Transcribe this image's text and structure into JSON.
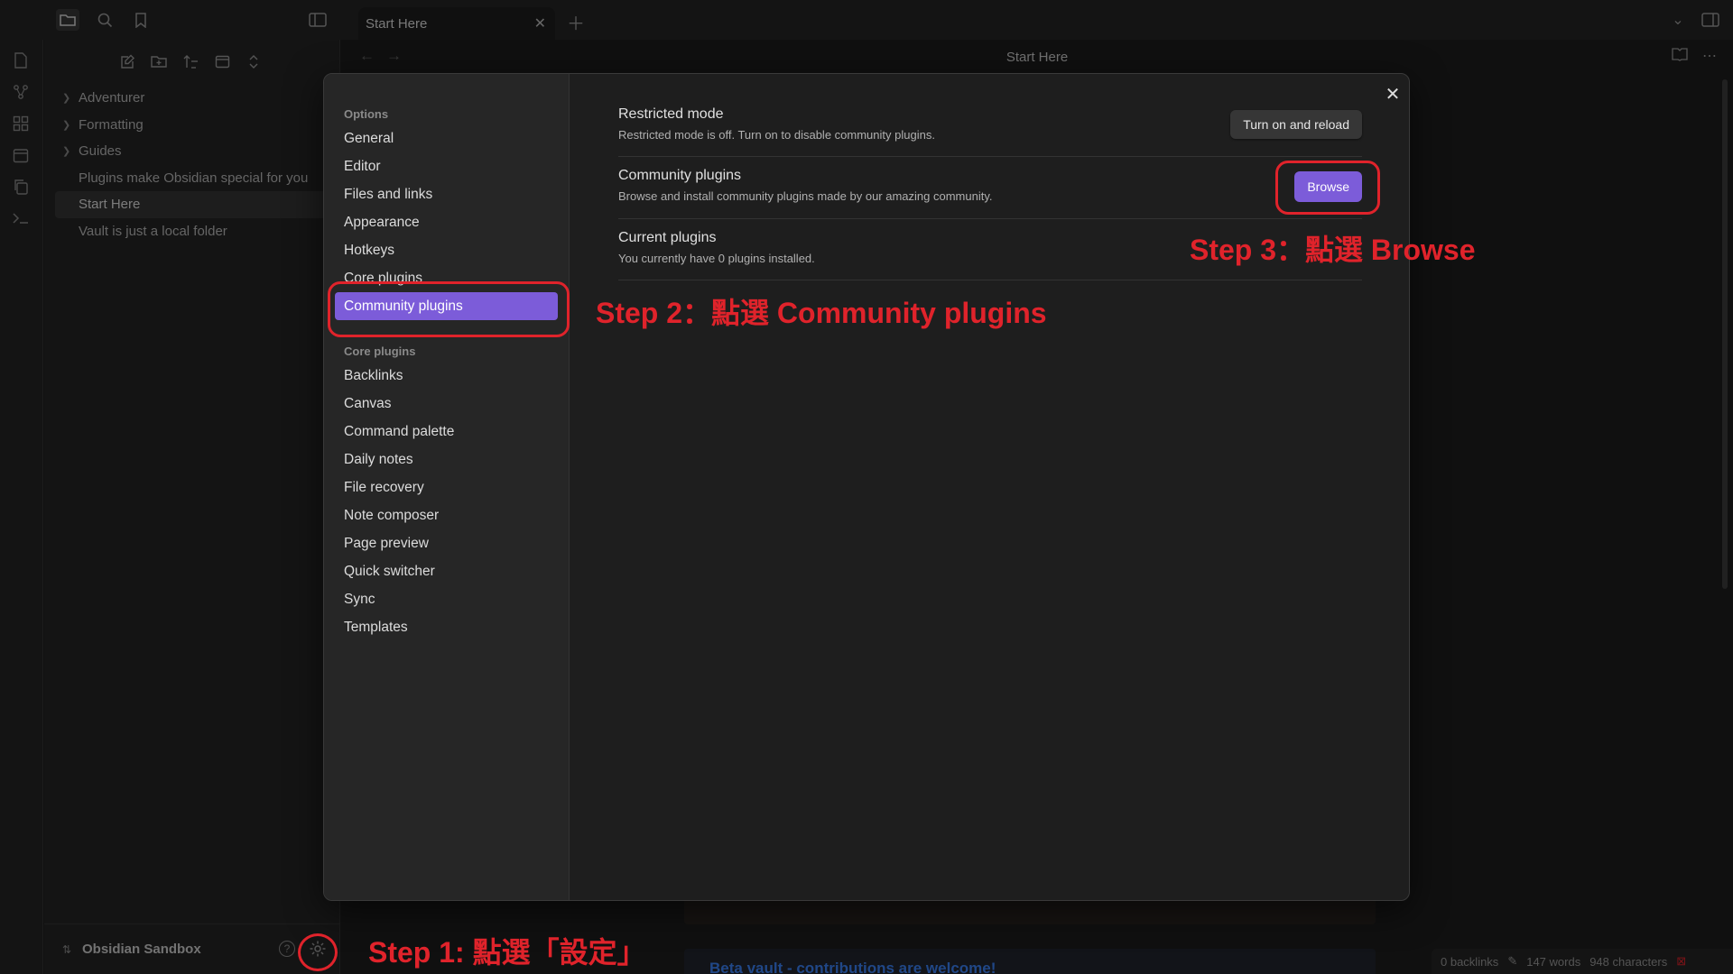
{
  "tab": {
    "title": "Start Here"
  },
  "file_tree": [
    {
      "label": "Adventurer",
      "folder": true
    },
    {
      "label": "Formatting",
      "folder": true
    },
    {
      "label": "Guides",
      "folder": true
    },
    {
      "label": "Plugins make Obsidian special for you",
      "folder": false
    },
    {
      "label": "Start Here",
      "folder": false,
      "active": true
    },
    {
      "label": "Vault is just a local folder",
      "folder": false
    }
  ],
  "vault": {
    "name": "Obsidian Sandbox"
  },
  "editor": {
    "title": "Start Here",
    "callout": "Beta vault - contributions are welcome!"
  },
  "status": {
    "backlinks": "0 backlinks",
    "words": "147 words",
    "characters": "948 characters"
  },
  "settings_nav": {
    "options_heading": "Options",
    "options": [
      "General",
      "Editor",
      "Files and links",
      "Appearance",
      "Hotkeys",
      "Core plugins",
      "Community plugins"
    ],
    "core_heading": "Core plugins",
    "core": [
      "Backlinks",
      "Canvas",
      "Command palette",
      "Daily notes",
      "File recovery",
      "Note composer",
      "Page preview",
      "Quick switcher",
      "Sync",
      "Templates"
    ]
  },
  "settings": {
    "restricted": {
      "name": "Restricted mode",
      "desc": "Restricted mode is off. Turn on to disable community plugins.",
      "button": "Turn on and reload"
    },
    "community": {
      "name": "Community plugins",
      "desc": "Browse and install community plugins made by our amazing community.",
      "button": "Browse"
    },
    "current": {
      "name": "Current plugins",
      "desc": "You currently have 0 plugins installed."
    }
  },
  "annotations": {
    "step1": "Step 1: 點選「設定」",
    "step2": "Step 2：點選 Community plugins",
    "step3": "Step 3：點選 Browse"
  },
  "colors": {
    "accent": "#7c5cd9",
    "annotation": "#e0232b",
    "link": "#3b82f6"
  }
}
